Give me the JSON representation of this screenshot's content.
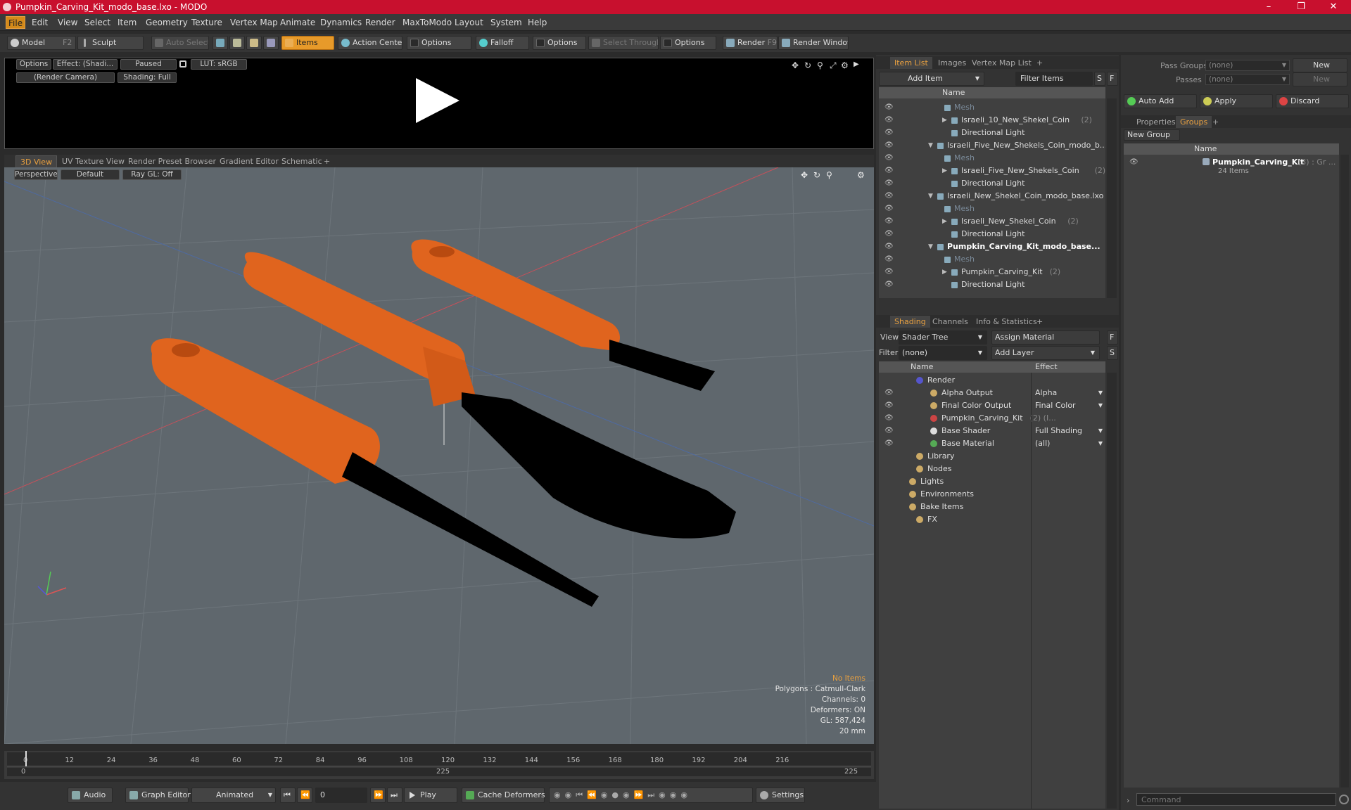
{
  "title": "Pumpkin_Carving_Kit_modo_base.lxo - MODO",
  "menu": [
    "File",
    "Edit",
    "View",
    "Select",
    "Item",
    "Geometry",
    "Texture",
    "Vertex Map",
    "Animate",
    "Dynamics",
    "Render",
    "MaxToModo",
    "Layout",
    "System",
    "Help"
  ],
  "toolbar": {
    "model": "Model",
    "model_key": "F2",
    "sculpt": "Sculpt",
    "auto_select": "Auto Select",
    "items": "Items",
    "action_center": "Action Center",
    "options": "Options",
    "falloff": "Falloff",
    "select_through": "Select Through",
    "render": "Render",
    "render_key": "F9",
    "render_window": "Render Window"
  },
  "preview": {
    "options": "Options",
    "effect": "Effect: (Shadi...",
    "paused": "Paused",
    "lut": "LUT: sRGB",
    "camera": "(Render Camera)",
    "shading": "Shading: Full"
  },
  "view_tabs": [
    "3D View",
    "UV Texture View",
    "Render Preset Browser",
    "Gradient Editor",
    "Schematic",
    "+"
  ],
  "viewport": {
    "perspective": "Perspective",
    "default": "Default",
    "raygl": "Ray GL: Off",
    "info": {
      "no_items": "No Items",
      "polygons": "Polygons : Catmull-Clark",
      "channels": "Channels: 0",
      "deformers": "Deformers: ON",
      "gl": "GL: 587,424",
      "size": "20 mm"
    }
  },
  "timeline": {
    "ticks": [
      "0",
      "12",
      "24",
      "36",
      "48",
      "60",
      "72",
      "84",
      "96",
      "108",
      "120",
      "132",
      "144",
      "156",
      "168",
      "180",
      "192",
      "204",
      "216"
    ],
    "start": "0",
    "mid": "225",
    "end": "225"
  },
  "bottom": {
    "audio": "Audio",
    "graph_editor": "Graph Editor",
    "animated": "Animated",
    "frame": "0",
    "play": "Play",
    "cache": "Cache Deformers",
    "settings": "Settings"
  },
  "item_list": {
    "tabs": [
      "Item List",
      "Images",
      "Vertex Map List",
      "+"
    ],
    "add_item": "Add Item",
    "filter_items": "Filter Items",
    "s": "S",
    "f": "F",
    "col_name": "Name",
    "rows": [
      {
        "label": "Mesh",
        "cls": "dim2",
        "indent": 95,
        "tri": ""
      },
      {
        "label": "Israeli_10_New_Shekel_Coin",
        "count": "(2)",
        "indent": 105,
        "tri": "▶"
      },
      {
        "label": "Directional Light",
        "indent": 105,
        "tri": ""
      },
      {
        "label": "Israeli_Five_New_Shekels_Coin_modo_b...",
        "indent": 85,
        "tri": "▼"
      },
      {
        "label": "Mesh",
        "cls": "dim2",
        "indent": 95,
        "tri": ""
      },
      {
        "label": "Israeli_Five_New_Shekels_Coin",
        "count": "(2)",
        "indent": 105,
        "tri": "▶"
      },
      {
        "label": "Directional Light",
        "indent": 105,
        "tri": ""
      },
      {
        "label": "Israeli_New_Shekel_Coin_modo_base.lxo",
        "indent": 85,
        "tri": "▼"
      },
      {
        "label": "Mesh",
        "cls": "dim2",
        "indent": 95,
        "tri": ""
      },
      {
        "label": "Israeli_New_Shekel_Coin",
        "count": "(2)",
        "indent": 105,
        "tri": "▶"
      },
      {
        "label": "Directional Light",
        "indent": 105,
        "tri": ""
      },
      {
        "label": "Pumpkin_Carving_Kit_modo_base...",
        "cls": "bold",
        "indent": 85,
        "tri": "▼"
      },
      {
        "label": "Mesh",
        "cls": "dim2",
        "indent": 95,
        "tri": ""
      },
      {
        "label": "Pumpkin_Carving_Kit",
        "count": "(2)",
        "indent": 105,
        "tri": "▶"
      },
      {
        "label": "Directional Light",
        "indent": 105,
        "tri": ""
      }
    ]
  },
  "shading": {
    "tabs": [
      "Shading",
      "Channels",
      "Info & Statistics",
      "+"
    ],
    "view_label": "View",
    "view_value": "Shader Tree",
    "assign_material": "Assign Material",
    "filter_label": "Filter",
    "filter_value": "(none)",
    "add_layer": "Add Layer",
    "col_name": "Name",
    "col_effect": "Effect",
    "rows": [
      {
        "label": "Render",
        "effect": "",
        "indent": 55
      },
      {
        "label": "Alpha Output",
        "effect": "Alpha",
        "indent": 75
      },
      {
        "label": "Final Color Output",
        "effect": "Final Color",
        "indent": 75
      },
      {
        "label": "Pumpkin_Carving_Kit",
        "count": "(2) (I...",
        "effect": "",
        "indent": 75
      },
      {
        "label": "Base Shader",
        "effect": "Full Shading",
        "indent": 75
      },
      {
        "label": "Base Material",
        "effect": "(all)",
        "indent": 75
      },
      {
        "label": "Library",
        "effect": "",
        "indent": 55
      },
      {
        "label": "Nodes",
        "effect": "",
        "indent": 55
      },
      {
        "label": "Lights",
        "effect": "",
        "indent": 45
      },
      {
        "label": "Environments",
        "effect": "",
        "indent": 45
      },
      {
        "label": "Bake Items",
        "effect": "",
        "indent": 45
      },
      {
        "label": "FX",
        "effect": "",
        "indent": 55
      }
    ]
  },
  "groups": {
    "pass_groups": "Pass Groups",
    "passes": "Passes",
    "none": "(none)",
    "new": "New",
    "auto_add": "Auto Add",
    "apply": "Apply",
    "discard": "Discard",
    "tabs": [
      "Properties",
      "Groups",
      "+"
    ],
    "new_group": "New Group",
    "col_name": "Name",
    "item_name": "Pumpkin_Carving_Kit",
    "item_count": "(3) : Gr ...",
    "item_sub": "24 Items"
  },
  "command": {
    "placeholder": "Command"
  },
  "colors": {
    "accent": "#e79a2a",
    "title": "#c8102e",
    "orange": "#e0641e"
  }
}
